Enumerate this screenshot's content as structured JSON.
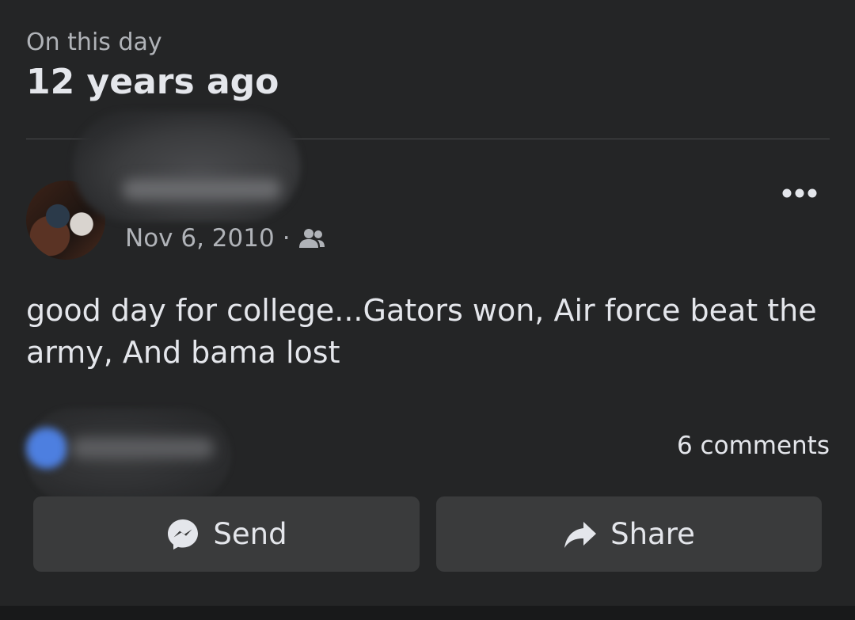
{
  "memory": {
    "kicker": "On this day",
    "title": "12 years ago"
  },
  "post": {
    "date": "Nov 6, 2010",
    "separator": "·",
    "audience_icon": "friends-icon",
    "text": "good day for college...Gators won, Air force beat the army, And bama lost",
    "more_icon": "more-horizontal-icon"
  },
  "engagement": {
    "comments": "6 comments"
  },
  "actions": {
    "send_label": "Send",
    "send_icon": "messenger-icon",
    "share_label": "Share",
    "share_icon": "share-arrow-icon"
  },
  "colors": {
    "background": "#242526",
    "button": "#3a3b3c",
    "text_primary": "#e4e6eb",
    "text_secondary": "#b0b3b8"
  }
}
